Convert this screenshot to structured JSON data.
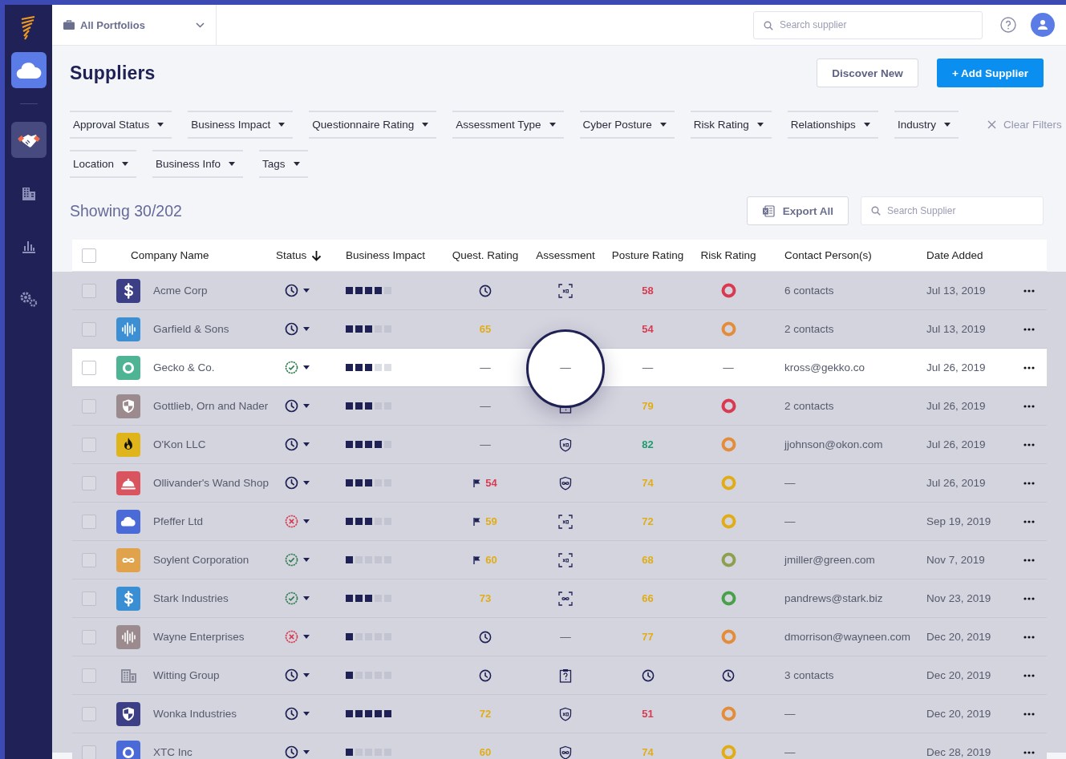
{
  "sidebar": {
    "items": [
      {
        "kind": "cloud",
        "selected": true,
        "hovered": false
      },
      {
        "kind": "handshake",
        "selected": false,
        "hovered": true
      },
      {
        "kind": "building",
        "selected": false,
        "hovered": false
      },
      {
        "kind": "chart",
        "selected": false,
        "hovered": false
      },
      {
        "kind": "gears",
        "selected": false,
        "hovered": false
      }
    ]
  },
  "top_bar": {
    "portfolio": "All Portfolios",
    "search": {
      "placeholder": "Search supplier"
    }
  },
  "page": {
    "title": "Suppliers",
    "buttons": [
      {
        "label": "Discover New",
        "kind": "secondary"
      },
      {
        "label": "+ Add Supplier",
        "kind": "primary"
      }
    ]
  },
  "filter_rows": [
    {
      "filters": [
        "Approval Status",
        "Business Impact",
        "Questionnaire Rating",
        "Assessment Type",
        "Cyber Posture",
        "Risk Rating",
        "Relationships",
        "Industry"
      ],
      "clear": "Clear Filters"
    },
    {
      "filters": [
        "Location",
        "Business Info",
        "Tags"
      ]
    }
  ],
  "results": {
    "showing": "Showing 30/202",
    "export": "Export All",
    "search": {
      "placeholder": "Search Supplier"
    }
  },
  "table": {
    "select_all": {
      "checked": false
    },
    "columns": [
      {
        "label": "Company Name",
        "sorted": false
      },
      {
        "label": "Status",
        "sorted": true
      },
      {
        "label": "Business Impact",
        "sorted": false
      },
      {
        "label": "Quest. Rating",
        "sorted": false
      },
      {
        "label": "Assessment",
        "sorted": false
      },
      {
        "label": "Posture Rating",
        "sorted": false
      },
      {
        "label": "Risk Rating",
        "sorted": false
      },
      {
        "label": "Contact Person(s)",
        "sorted": false
      },
      {
        "label": "Date Added",
        "sorted": false
      }
    ],
    "rows": [
      {
        "checked": false,
        "highlighted": false,
        "magnified": false,
        "logo": {
          "kind": "dollar",
          "color": "#3c3f85"
        },
        "company": "Acme Corp",
        "status": {
          "kind": "pending"
        },
        "impact": {
          "level": 0.8
        },
        "quest": {
          "kind": "pending"
        },
        "assessment": {
          "kind": "x2-scan"
        },
        "posture": {
          "kind": "score",
          "text": "58",
          "color": "#d93a4f"
        },
        "risk": {
          "kind": "ring",
          "color": "#d93a4f"
        },
        "contact": "6 contacts",
        "date": "Jul 13, 2019"
      },
      {
        "checked": false,
        "highlighted": false,
        "magnified": false,
        "logo": {
          "kind": "wave",
          "color": "#3d8fd4"
        },
        "company": "Garfield & Sons",
        "status": {
          "kind": "pending"
        },
        "impact": {
          "level": 0.6
        },
        "quest": {
          "kind": "score",
          "text": "65",
          "color": "#e0ad17",
          "flagged": false
        },
        "posture": {
          "kind": "score",
          "text": "54",
          "color": "#d93a4f"
        },
        "risk": {
          "kind": "ring",
          "color": "#e38d3b"
        },
        "contact": "2 contacts",
        "date": "Jul 13, 2019"
      },
      {
        "checked": false,
        "highlighted": true,
        "magnified": true,
        "logo": {
          "kind": "ring",
          "color": "#4fb494"
        },
        "company": "Gecko & Co.",
        "status": {
          "kind": "approved"
        },
        "impact": {
          "level": 0.6
        },
        "quest": {
          "kind": "none",
          "text": "—"
        },
        "assessment": {
          "kind": "none",
          "text": "—"
        },
        "posture": {
          "kind": "none",
          "text": "—"
        },
        "risk": {
          "kind": "none",
          "text": "—"
        },
        "contact": "kross@gekko.co",
        "date": "Jul 26, 2019"
      },
      {
        "checked": false,
        "highlighted": false,
        "magnified": false,
        "logo": {
          "kind": "shield",
          "color": "#9b8a8e"
        },
        "company": "Gottlieb, Orn and Nader",
        "status": {
          "kind": "pending"
        },
        "impact": {
          "level": 0.6
        },
        "quest": {
          "kind": "none",
          "text": "—"
        },
        "assessment": {
          "kind": "question"
        },
        "posture": {
          "kind": "score",
          "text": "79",
          "color": "#e0ad17"
        },
        "risk": {
          "kind": "ring",
          "color": "#d93a4f"
        },
        "contact": "2 contacts",
        "date": "Jul 26, 2019"
      },
      {
        "checked": false,
        "highlighted": false,
        "magnified": false,
        "logo": {
          "kind": "flame",
          "color": "#e0b51c"
        },
        "company": "O'Kon LLC",
        "status": {
          "kind": "pending"
        },
        "impact": {
          "level": 0.8
        },
        "quest": {
          "kind": "none",
          "text": "—"
        },
        "assessment": {
          "kind": "x2-shield"
        },
        "posture": {
          "kind": "score",
          "text": "82",
          "color": "#1f9b6b"
        },
        "risk": {
          "kind": "ring",
          "color": "#e38d3b"
        },
        "contact": "jjohnson@okon.com",
        "date": "Jul 26, 2019"
      },
      {
        "checked": false,
        "highlighted": false,
        "magnified": false,
        "logo": {
          "kind": "bell",
          "color": "#d9545f"
        },
        "company": "Ollivander's Wand Shop",
        "status": {
          "kind": "pending"
        },
        "impact": {
          "level": 0.6
        },
        "quest": {
          "kind": "score",
          "text": "54",
          "color": "#d93a4f",
          "flagged": true
        },
        "assessment": {
          "kind": "infinity-shield"
        },
        "posture": {
          "kind": "score",
          "text": "74",
          "color": "#e0ad17"
        },
        "risk": {
          "kind": "ring",
          "color": "#e0ad17"
        },
        "contact": "—",
        "date": "Jul 26, 2019"
      },
      {
        "checked": false,
        "highlighted": false,
        "magnified": false,
        "logo": {
          "kind": "cloud",
          "color": "#4a6ad8"
        },
        "company": "Pfeffer Ltd",
        "status": {
          "kind": "rejected"
        },
        "impact": {
          "level": 0.6
        },
        "quest": {
          "kind": "score",
          "text": "59",
          "color": "#e0ad17",
          "flagged": true
        },
        "assessment": {
          "kind": "x2-scan"
        },
        "posture": {
          "kind": "score",
          "text": "72",
          "color": "#e0ad17"
        },
        "risk": {
          "kind": "ring",
          "color": "#e0ad17"
        },
        "contact": "—",
        "date": "Sep 19, 2019"
      },
      {
        "checked": false,
        "highlighted": false,
        "magnified": false,
        "logo": {
          "kind": "infinity",
          "color": "#e0a24a"
        },
        "company": "Soylent Corporation",
        "status": {
          "kind": "approved"
        },
        "impact": {
          "level": 0.2
        },
        "quest": {
          "kind": "score",
          "text": "60",
          "color": "#e0ad17",
          "flagged": true
        },
        "assessment": {
          "kind": "x2-scan"
        },
        "posture": {
          "kind": "score",
          "text": "68",
          "color": "#e0ad17"
        },
        "risk": {
          "kind": "ring",
          "color": "#8ca050"
        },
        "contact": "jmiller@green.com",
        "date": "Nov 7, 2019"
      },
      {
        "checked": false,
        "highlighted": false,
        "magnified": false,
        "logo": {
          "kind": "dollar",
          "color": "#3a8ed4"
        },
        "company": "Stark Industries",
        "status": {
          "kind": "approved"
        },
        "impact": {
          "level": 0.6
        },
        "quest": {
          "kind": "score",
          "text": "73",
          "color": "#e0ad17",
          "flagged": false
        },
        "assessment": {
          "kind": "infinity-scan"
        },
        "posture": {
          "kind": "score",
          "text": "66",
          "color": "#e0ad17"
        },
        "risk": {
          "kind": "ring",
          "color": "#48a048"
        },
        "contact": "pandrews@stark.biz",
        "date": "Nov 23, 2019"
      },
      {
        "checked": false,
        "highlighted": false,
        "magnified": false,
        "logo": {
          "kind": "wave",
          "color": "#9b8a8e"
        },
        "company": "Wayne Enterprises",
        "status": {
          "kind": "rejected"
        },
        "impact": {
          "level": 0.2
        },
        "quest": {
          "kind": "pending"
        },
        "assessment": {
          "kind": "none",
          "text": "—"
        },
        "posture": {
          "kind": "score",
          "text": "77",
          "color": "#e0ad17"
        },
        "risk": {
          "kind": "ring",
          "color": "#e38d3b"
        },
        "contact": "dmorrison@wayneen.com",
        "date": "Dec 20, 2019"
      },
      {
        "checked": false,
        "highlighted": false,
        "magnified": false,
        "logo": {
          "kind": "building",
          "color": "#8a8c9c"
        },
        "company": "Witting Group",
        "status": {
          "kind": "pending"
        },
        "impact": {
          "level": 0.2
        },
        "quest": {
          "kind": "pending"
        },
        "assessment": {
          "kind": "question"
        },
        "posture": {
          "kind": "pending"
        },
        "risk": {
          "kind": "pending"
        },
        "contact": "3 contacts",
        "date": "Dec 20, 2019"
      },
      {
        "checked": false,
        "highlighted": false,
        "magnified": false,
        "logo": {
          "kind": "shield",
          "color": "#3c3f85"
        },
        "company": "Wonka Industries",
        "status": {
          "kind": "pending"
        },
        "impact": {
          "level": 1
        },
        "quest": {
          "kind": "score",
          "text": "72",
          "color": "#e0ad17",
          "flagged": false
        },
        "assessment": {
          "kind": "x2-shield"
        },
        "posture": {
          "kind": "score",
          "text": "51",
          "color": "#d93a4f"
        },
        "risk": {
          "kind": "ring",
          "color": "#e38d3b"
        },
        "contact": "—",
        "date": "Dec 20, 2019"
      },
      {
        "checked": false,
        "highlighted": false,
        "magnified": false,
        "logo": {
          "kind": "ring",
          "color": "#4a6ad8"
        },
        "company": "XTC Inc",
        "status": {
          "kind": "pending"
        },
        "impact": {
          "level": 0.2
        },
        "quest": {
          "kind": "score",
          "text": "60",
          "color": "#e0ad17",
          "flagged": false
        },
        "assessment": {
          "kind": "infinity-shield"
        },
        "posture": {
          "kind": "score",
          "text": "74",
          "color": "#e0ad17"
        },
        "risk": {
          "kind": "ring",
          "color": "#e0ad17"
        },
        "contact": "—",
        "date": "Dec 28, 2019"
      }
    ]
  }
}
